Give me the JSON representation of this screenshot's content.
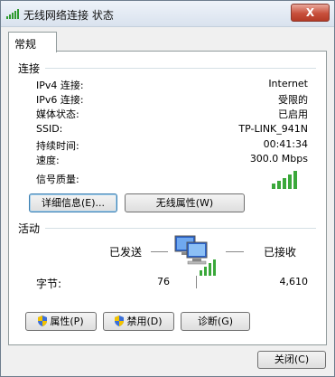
{
  "window": {
    "title": "无线网络连接 状态",
    "close_glyph": "X"
  },
  "tab": {
    "label": "常规"
  },
  "connection": {
    "section_label": "连接",
    "rows": [
      {
        "label": "IPv4 连接:",
        "value": "Internet"
      },
      {
        "label": "IPv6 连接:",
        "value": "受限的"
      },
      {
        "label": "媒体状态:",
        "value": "已启用"
      },
      {
        "label": "SSID:",
        "value": "TP-LINK_941N"
      },
      {
        "label": "持续时间:",
        "value": "00:41:34"
      },
      {
        "label": "速度:",
        "value": "300.0 Mbps"
      }
    ],
    "signal_label": "信号质量:",
    "signal_bars": 5,
    "details_button": "详细信息(E)...",
    "wireless_button": "无线属性(W)"
  },
  "activity": {
    "section_label": "活动",
    "sent_label": "已发送",
    "received_label": "已接收",
    "bytes_label": "字节:",
    "bytes_sent": "76",
    "bytes_received": "4,610"
  },
  "buttons": {
    "properties": "属性(P)",
    "disable": "禁用(D)",
    "diagnose": "诊断(G)"
  },
  "footer": {
    "close_button": "关闭(C)"
  },
  "colors": {
    "signal": "#3aa83a",
    "close": "#c8503c",
    "shield_blue": "#3b6fd8",
    "shield_yellow": "#f2c200"
  }
}
